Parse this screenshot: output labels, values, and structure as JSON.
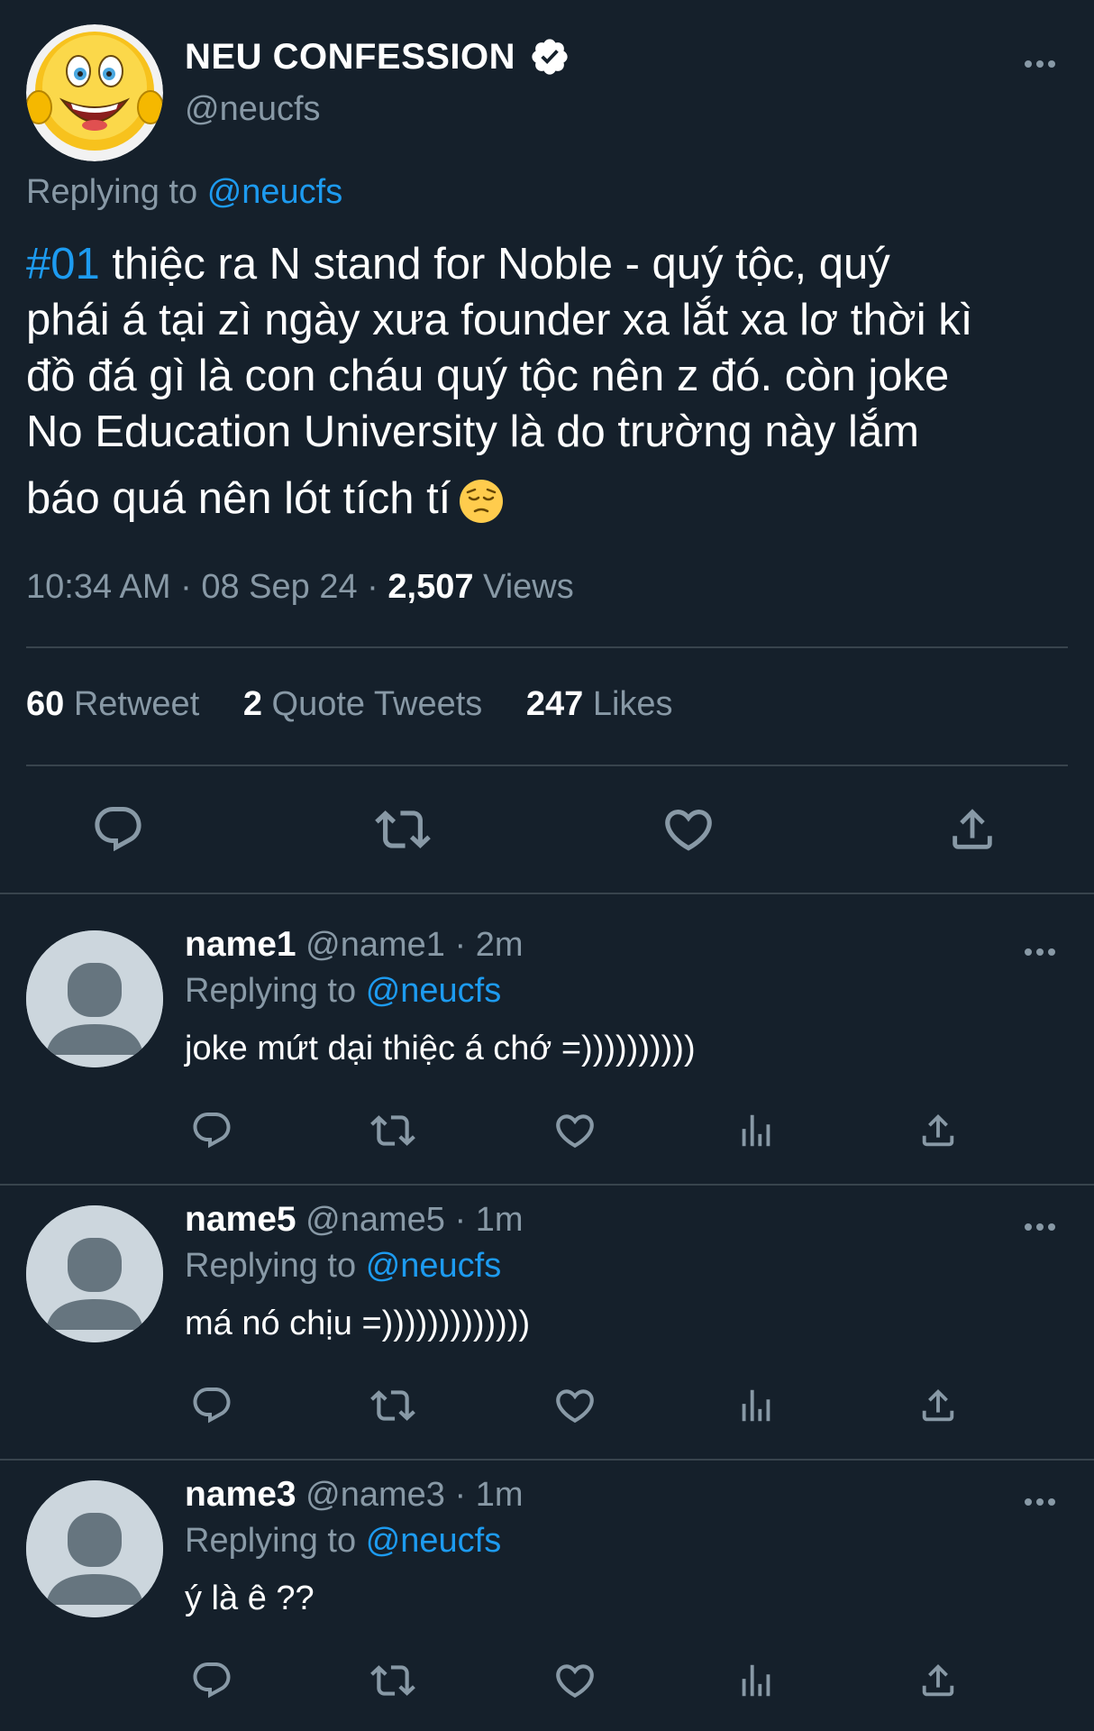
{
  "tweet": {
    "display_name": "NEU CONFESSION",
    "handle": "@neucfs",
    "replying_prefix": "Replying to",
    "replying_to": "@neucfs",
    "hashtag": "#01",
    "body_line1": " thiệc ra N stand for Noble - quý tộc, quý",
    "body_line2": "phái á tại zì ngày xưa founder xa lắt xa lơ thời kì",
    "body_line3": "đồ đá gì là con cháu quý tộc nên z đó. còn joke",
    "body_line4": "No Education University là do trường này lắm",
    "body_line5": "báo quá nên lót tích tí",
    "time": "10:34 AM",
    "date": "08 Sep 24",
    "views_count": "2,507",
    "views_label": "Views",
    "separator": "·",
    "icons": [
      "verified-icon",
      "more-icon",
      "pensive-face-emoji"
    ]
  },
  "stats": {
    "retweets_count": "60",
    "retweets_label": "Retweet",
    "quotes_count": "2",
    "quotes_label": "Quote Tweets",
    "likes_count": "247",
    "likes_label": "Likes"
  },
  "actions": [
    "reply-icon",
    "retweet-icon",
    "like-icon",
    "share-icon"
  ],
  "replies": [
    {
      "name": "name1",
      "handle": "@name1",
      "dot": "·",
      "time": "2m",
      "replying_prefix": "Replying to",
      "replying_to": "@neucfs",
      "text": "joke mứt dại thiệc á chớ =))))))))))"
    },
    {
      "name": "name5",
      "handle": "@name5",
      "dot": "·",
      "time": "1m",
      "replying_prefix": "Replying to",
      "replying_to": "@neucfs",
      "text": "má nó chịu =)))))))))))))"
    },
    {
      "name": "name3",
      "handle": "@name3",
      "dot": "·",
      "time": "1m",
      "replying_prefix": "Replying to",
      "replying_to": "@neucfs",
      "text": "ý là ê ??"
    }
  ],
  "reply_actions": [
    "reply-icon",
    "retweet-icon",
    "like-icon",
    "analytics-icon",
    "share-icon"
  ],
  "colors": {
    "background": "#15202b",
    "accent": "#1d9bf0",
    "muted": "#8899a6",
    "divider": "#38444d"
  }
}
